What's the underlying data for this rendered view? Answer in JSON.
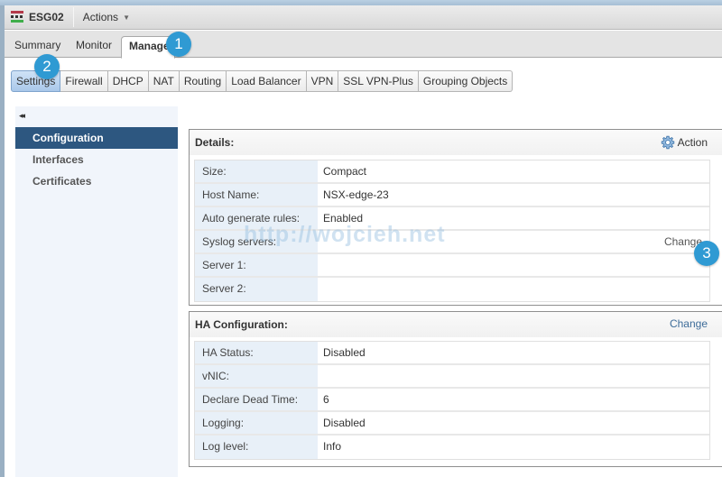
{
  "titlebar": {
    "title": "ESG02",
    "actions_label": "Actions"
  },
  "main_tabs": [
    {
      "label": "Summary",
      "active": false
    },
    {
      "label": "Monitor",
      "active": false
    },
    {
      "label": "Manage",
      "active": true
    }
  ],
  "sub_tabs": [
    {
      "label": "Settings",
      "active": true
    },
    {
      "label": "Firewall"
    },
    {
      "label": "DHCP"
    },
    {
      "label": "NAT"
    },
    {
      "label": "Routing"
    },
    {
      "label": "Load Balancer"
    },
    {
      "label": "VPN"
    },
    {
      "label": "SSL VPN-Plus"
    },
    {
      "label": "Grouping Objects"
    }
  ],
  "callouts": [
    "1",
    "2",
    "3"
  ],
  "sidebar": {
    "collapse_glyph": "◂◂",
    "items": [
      {
        "label": "Configuration",
        "active": true
      },
      {
        "label": "Interfaces"
      },
      {
        "label": "Certificates"
      }
    ]
  },
  "details": {
    "title": "Details:",
    "action_label": "Action",
    "rows": [
      {
        "label": "Size:",
        "value": "Compact"
      },
      {
        "label": "Host Name:",
        "value": "NSX-edge-23"
      },
      {
        "label": "Auto generate rules:",
        "value": "Enabled"
      },
      {
        "label": "Syslog servers:",
        "value": "",
        "link": "Change"
      },
      {
        "label": "Server 1:",
        "value": ""
      },
      {
        "label": "Server 2:",
        "value": ""
      }
    ]
  },
  "ha": {
    "title": "HA Configuration:",
    "change_label": "Change",
    "rows": [
      {
        "label": "HA Status:",
        "value": "Disabled"
      },
      {
        "label": "vNIC:",
        "value": ""
      },
      {
        "label": "Declare Dead Time:",
        "value": "6"
      },
      {
        "label": "Logging:",
        "value": "Disabled"
      },
      {
        "label": "Log level:",
        "value": "Info"
      }
    ]
  },
  "watermark": "http://wojcieh.net",
  "colors": {
    "accent": "#2f9ad3",
    "sidebar_active": "#2d5780",
    "link": "#3d6c99"
  }
}
